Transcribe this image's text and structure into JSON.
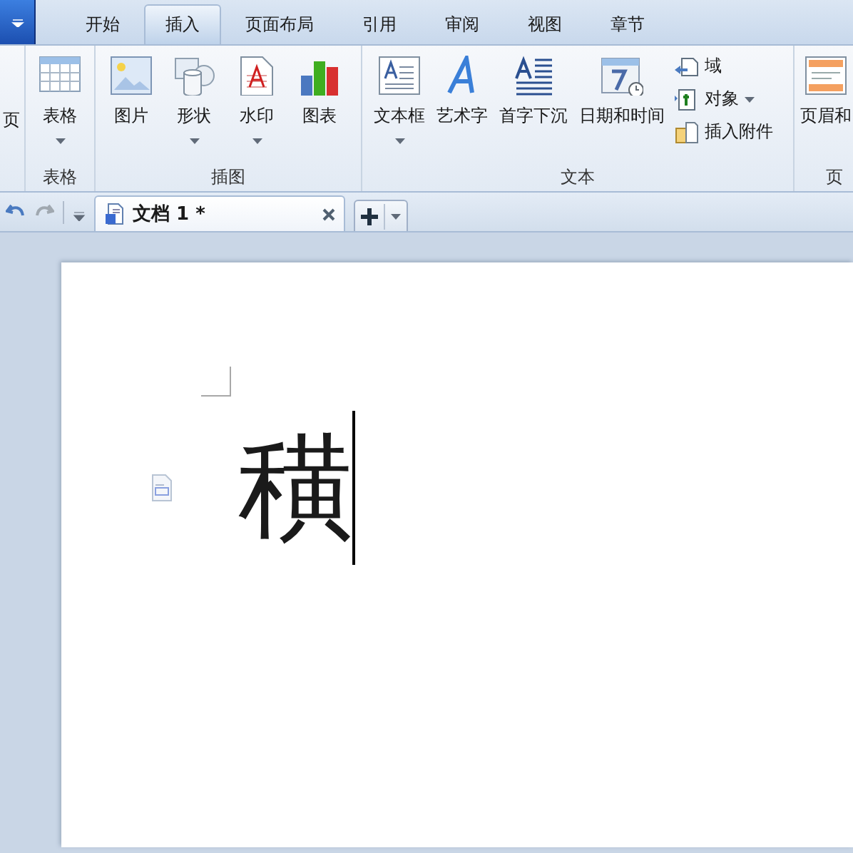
{
  "tabs": [
    {
      "label": "开始",
      "selected": false
    },
    {
      "label": "插入",
      "selected": true
    },
    {
      "label": "页面布局",
      "selected": false
    },
    {
      "label": "引用",
      "selected": false
    },
    {
      "label": "审阅",
      "selected": false
    },
    {
      "label": "视图",
      "selected": false
    },
    {
      "label": "章节",
      "selected": false
    }
  ],
  "ribbon": {
    "left_cut_label": "页",
    "groups": [
      {
        "label": "表格",
        "large": [
          {
            "label": "表格",
            "dropdown": true
          }
        ]
      },
      {
        "label": "插图",
        "large": [
          {
            "label": "图片",
            "dropdown": false
          },
          {
            "label": "形状",
            "dropdown": true
          },
          {
            "label": "水印",
            "dropdown": true
          },
          {
            "label": "图表",
            "dropdown": false
          }
        ]
      },
      {
        "label": "文本",
        "large": [
          {
            "label": "文本框",
            "dropdown": true
          },
          {
            "label": "艺术字",
            "dropdown": false
          },
          {
            "label": "首字下沉",
            "dropdown": false
          },
          {
            "label": "日期和时间",
            "dropdown": false
          }
        ],
        "small": [
          {
            "label": "域",
            "dropdown": false
          },
          {
            "label": "对象",
            "dropdown": true
          },
          {
            "label": "插入附件",
            "dropdown": false
          }
        ]
      },
      {
        "label": "页",
        "large": [
          {
            "label": "页眉和",
            "dropdown": false
          }
        ]
      }
    ]
  },
  "document_tab": {
    "title": "文档 1 *"
  },
  "document": {
    "text": "穔"
  }
}
